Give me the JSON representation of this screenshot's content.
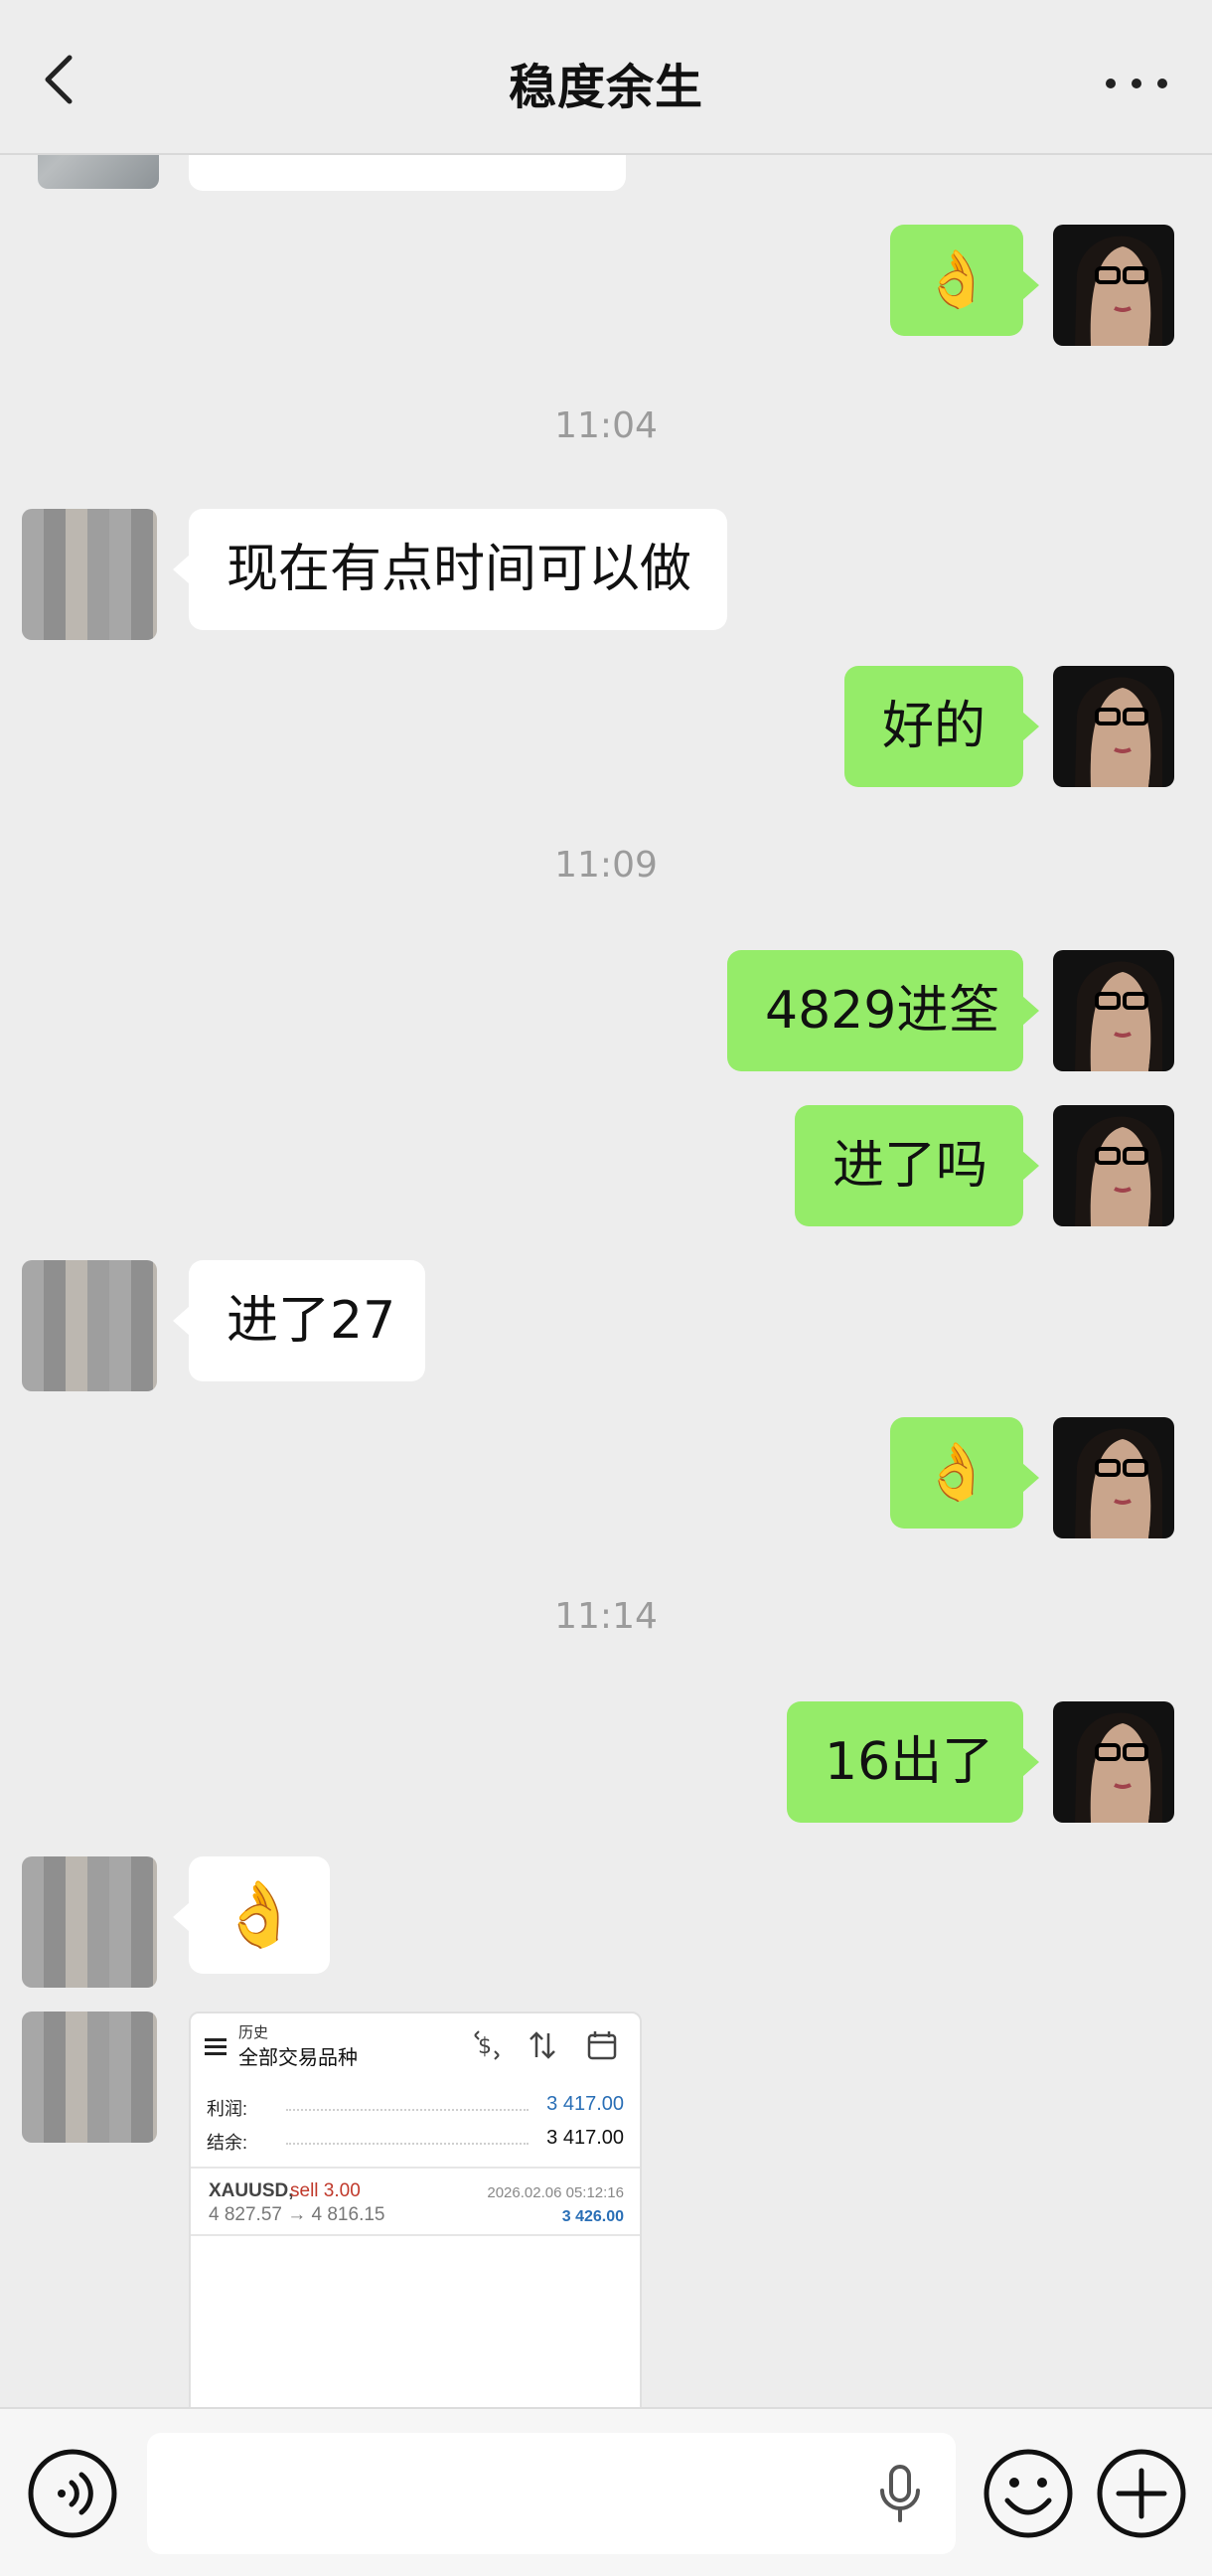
{
  "header": {
    "title": "稳度余生"
  },
  "times": {
    "t1": "11:04",
    "t2": "11:09",
    "t3": "11:14"
  },
  "messages": {
    "m1": "现在有点时间可以做",
    "m2": "好的",
    "m3": "4829进筌",
    "m4": "进了吗",
    "m5": "进了27",
    "m6": "16出了",
    "ok_emoji": "👌"
  },
  "card": {
    "section": "历史",
    "filter": "全部交易品种",
    "profit_label": "利润:",
    "profit_value": "3 417.00",
    "balance_label": "结余:",
    "balance_value": "3 417.00",
    "symbol": "XAUUSD,",
    "side": "sell 3.00",
    "prices": "4 827.57 → 4 816.15",
    "datetime": "2026.02.06 05:12:16",
    "pl": "3 426.00",
    "colors": {
      "blue": "#2a6fb6",
      "red": "#c0392b"
    }
  },
  "icons": {
    "back": "chevron-left-icon",
    "more": "more-dots-icon",
    "voice": "voice-icon",
    "mic": "microphone-icon",
    "emoji": "smiley-icon",
    "plus": "plus-icon"
  },
  "colors": {
    "bg": "#ededed",
    "bubble_out": "#95ec69",
    "bubble_in": "#ffffff",
    "timestamp": "#9b9b9b"
  }
}
